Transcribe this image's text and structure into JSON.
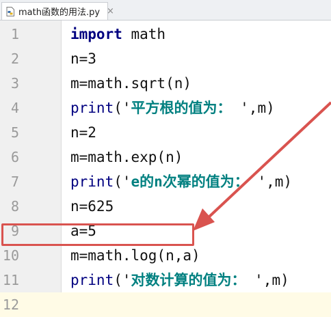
{
  "tab": {
    "title": "math函数的用法.py",
    "close": "×"
  },
  "colors": {
    "highlight_box": "#d9534f",
    "keyword": "#000080",
    "string": "#008080"
  },
  "lines": [
    {
      "num": "1",
      "parts": [
        {
          "t": "import",
          "c": "kw"
        },
        {
          "t": " math",
          "c": ""
        }
      ]
    },
    {
      "num": "2",
      "parts": [
        {
          "t": "n=3",
          "c": ""
        }
      ]
    },
    {
      "num": "3",
      "parts": [
        {
          "t": "m=math.sqrt(n)",
          "c": ""
        }
      ]
    },
    {
      "num": "4",
      "parts": [
        {
          "t": "print",
          "c": "fn"
        },
        {
          "t": "('",
          "c": ""
        },
        {
          "t": "平方根的值为：",
          "c": "str"
        },
        {
          "t": " ',m)",
          "c": ""
        }
      ]
    },
    {
      "num": "5",
      "parts": [
        {
          "t": "n=2",
          "c": ""
        }
      ]
    },
    {
      "num": "6",
      "parts": [
        {
          "t": "m=math.exp(n)",
          "c": ""
        }
      ]
    },
    {
      "num": "7",
      "parts": [
        {
          "t": "print",
          "c": "fn"
        },
        {
          "t": "('",
          "c": ""
        },
        {
          "t": "e的n次幂的值为：",
          "c": "str"
        },
        {
          "t": " ',m)",
          "c": ""
        }
      ]
    },
    {
      "num": "8",
      "parts": [
        {
          "t": "n=625",
          "c": ""
        }
      ]
    },
    {
      "num": "9",
      "parts": [
        {
          "t": "a=5",
          "c": ""
        }
      ]
    },
    {
      "num": "10",
      "parts": [
        {
          "t": "m=math.log(n,a)",
          "c": ""
        }
      ]
    },
    {
      "num": "11",
      "parts": [
        {
          "t": "print",
          "c": "fn"
        },
        {
          "t": "('",
          "c": ""
        },
        {
          "t": "对数计算的值为：",
          "c": "str"
        },
        {
          "t": " ',m)",
          "c": ""
        }
      ]
    },
    {
      "num": "12",
      "parts": []
    }
  ]
}
